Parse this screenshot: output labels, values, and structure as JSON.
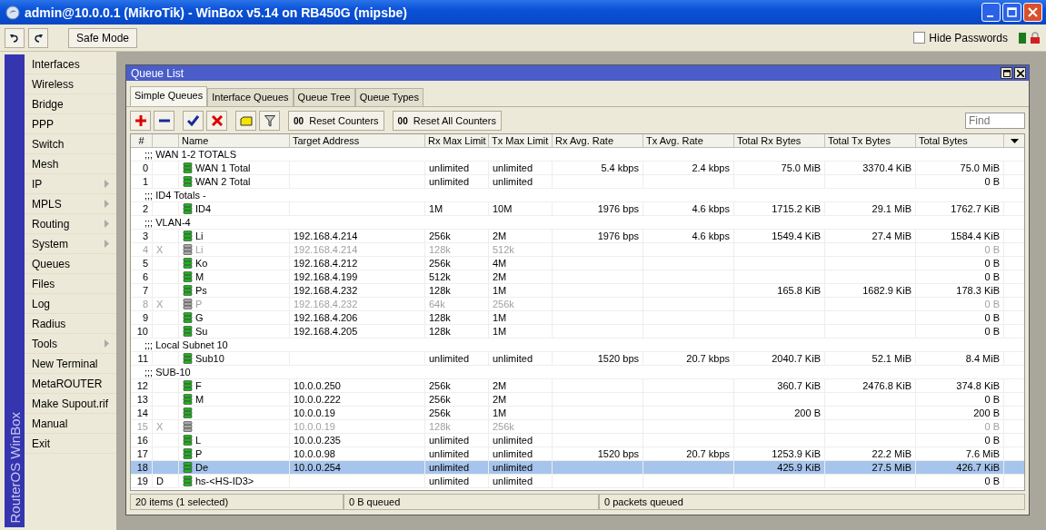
{
  "window": {
    "title": "admin@10.0.0.1 (MikroTik) - WinBox v5.14 on RB450G (mipsbe)"
  },
  "toolbar": {
    "safe_mode": "Safe Mode",
    "hide_passwords": {
      "label": "Hide Passwords",
      "checked": false
    }
  },
  "sidebar": {
    "brand": "RouterOS WinBox",
    "items": [
      {
        "label": "Interfaces",
        "submenu": false
      },
      {
        "label": "Wireless",
        "submenu": false
      },
      {
        "label": "Bridge",
        "submenu": false
      },
      {
        "label": "PPP",
        "submenu": false
      },
      {
        "label": "Switch",
        "submenu": false
      },
      {
        "label": "Mesh",
        "submenu": false
      },
      {
        "label": "IP",
        "submenu": true
      },
      {
        "label": "MPLS",
        "submenu": true
      },
      {
        "label": "Routing",
        "submenu": true
      },
      {
        "label": "System",
        "submenu": true
      },
      {
        "label": "Queues",
        "submenu": false
      },
      {
        "label": "Files",
        "submenu": false
      },
      {
        "label": "Log",
        "submenu": false
      },
      {
        "label": "Radius",
        "submenu": false
      },
      {
        "label": "Tools",
        "submenu": true
      },
      {
        "label": "New Terminal",
        "submenu": false
      },
      {
        "label": "MetaROUTER",
        "submenu": false
      },
      {
        "label": "Make Supout.rif",
        "submenu": false
      },
      {
        "label": "Manual",
        "submenu": false
      },
      {
        "label": "Exit",
        "submenu": false
      }
    ]
  },
  "queue_window": {
    "title": "Queue List",
    "tabs": [
      {
        "label": "Simple Queues",
        "selected": true
      },
      {
        "label": "Interface Queues",
        "selected": false
      },
      {
        "label": "Queue Tree",
        "selected": false
      },
      {
        "label": "Queue Types",
        "selected": false
      }
    ],
    "buttons": [
      {
        "label": "Reset Counters",
        "icon": "00"
      },
      {
        "label": "Reset All Counters",
        "icon": "00"
      }
    ],
    "find": {
      "placeholder": "Find"
    },
    "table": {
      "columns": [
        "#",
        "Name",
        "Target Address",
        "Rx Max Limit",
        "Tx Max Limit",
        "Rx Avg. Rate",
        "Tx Avg. Rate",
        "Total Rx Bytes",
        "Total Tx Bytes",
        "Total Bytes"
      ],
      "rows": [
        {
          "kind": "comment",
          "text": ";;; WAN 1-2 TOTALS"
        },
        {
          "kind": "queue",
          "num": "0",
          "name": "WAN 1 Total",
          "rx_max": "unlimited",
          "tx_max": "unlimited",
          "rx_avg": "5.4 kbps",
          "tx_avg": "2.4 kbps",
          "total_rx": "75.0 MiB",
          "total_tx": "3370.4 KiB",
          "total": "75.0 MiB",
          "disabled": false,
          "selected": false
        },
        {
          "kind": "queue",
          "num": "1",
          "name": "WAN 2 Total",
          "rx_max": "unlimited",
          "tx_max": "unlimited",
          "total": "0 B",
          "disabled": false,
          "selected": false
        },
        {
          "kind": "comment",
          "text": ";;; ID4 Totals -"
        },
        {
          "kind": "queue",
          "num": "2",
          "name": "ID4",
          "rx_max": "1M",
          "tx_max": "10M",
          "rx_avg": "1976 bps",
          "tx_avg": "4.6 kbps",
          "total_rx": "1715.2 KiB",
          "total_tx": "29.1 MiB",
          "total": "1762.7 KiB",
          "disabled": false,
          "selected": false
        },
        {
          "kind": "comment",
          "text": ";;; VLAN-4"
        },
        {
          "kind": "queue",
          "num": "3",
          "name": "Li",
          "target": "192.168.4.214",
          "rx_max": "256k",
          "tx_max": "2M",
          "rx_avg": "1976 bps",
          "tx_avg": "4.6 kbps",
          "total_rx": "1549.4 KiB",
          "total_tx": "27.4 MiB",
          "total": "1584.4 KiB",
          "disabled": false,
          "selected": false
        },
        {
          "kind": "queue",
          "num": "4",
          "flag": "X",
          "name": "Li",
          "target": "192.168.4.214",
          "rx_max": "128k",
          "tx_max": "512k",
          "total": "0 B",
          "disabled": true,
          "selected": false
        },
        {
          "kind": "queue",
          "num": "5",
          "name": "Ko",
          "target": "192.168.4.212",
          "rx_max": "256k",
          "tx_max": "4M",
          "total": "0 B",
          "disabled": false,
          "selected": false
        },
        {
          "kind": "queue",
          "num": "6",
          "name": "M",
          "target": "192.168.4.199",
          "rx_max": "512k",
          "tx_max": "2M",
          "total": "0 B",
          "disabled": false,
          "selected": false
        },
        {
          "kind": "queue",
          "num": "7",
          "name": "Ps",
          "target": "192.168.4.232",
          "rx_max": "128k",
          "tx_max": "1M",
          "total_rx": "165.8 KiB",
          "total_tx": "1682.9 KiB",
          "total": "178.3 KiB",
          "disabled": false,
          "selected": false
        },
        {
          "kind": "queue",
          "num": "8",
          "flag": "X",
          "name": "P",
          "target": "192.168.4.232",
          "rx_max": "64k",
          "tx_max": "256k",
          "total": "0 B",
          "disabled": true,
          "selected": false
        },
        {
          "kind": "queue",
          "num": "9",
          "name": "G",
          "target": "192.168.4.206",
          "rx_max": "128k",
          "tx_max": "1M",
          "total": "0 B",
          "disabled": false,
          "selected": false
        },
        {
          "kind": "queue",
          "num": "10",
          "name": "Su",
          "target": "192.168.4.205",
          "rx_max": "128k",
          "tx_max": "1M",
          "total": "0 B",
          "disabled": false,
          "selected": false
        },
        {
          "kind": "comment",
          "text": ";;; Local Subnet 10"
        },
        {
          "kind": "queue",
          "num": "11",
          "name": "Sub10",
          "rx_max": "unlimited",
          "tx_max": "unlimited",
          "rx_avg": "1520 bps",
          "tx_avg": "20.7 kbps",
          "total_rx": "2040.7 KiB",
          "total_tx": "52.1 MiB",
          "total": "8.4 MiB",
          "disabled": false,
          "selected": false
        },
        {
          "kind": "comment",
          "text": ";;; SUB-10"
        },
        {
          "kind": "queue",
          "num": "12",
          "name": "F",
          "target": "10.0.0.250",
          "rx_max": "256k",
          "tx_max": "2M",
          "total_rx": "360.7 KiB",
          "total_tx": "2476.8 KiB",
          "total": "374.8 KiB",
          "disabled": false,
          "selected": false
        },
        {
          "kind": "queue",
          "num": "13",
          "name": "M",
          "target": "10.0.0.222",
          "rx_max": "256k",
          "tx_max": "2M",
          "total": "0 B",
          "disabled": false,
          "selected": false
        },
        {
          "kind": "queue",
          "num": "14",
          "target": "10.0.0.19",
          "rx_max": "256k",
          "tx_max": "1M",
          "total_rx": "200 B",
          "total": "200 B",
          "disabled": false,
          "selected": false
        },
        {
          "kind": "queue",
          "num": "15",
          "flag": "X",
          "target": "10.0.0.19",
          "rx_max": "128k",
          "tx_max": "256k",
          "total": "0 B",
          "disabled": true,
          "selected": false
        },
        {
          "kind": "queue",
          "num": "16",
          "name": "L",
          "target": "10.0.0.235",
          "rx_max": "unlimited",
          "tx_max": "unlimited",
          "total": "0 B",
          "disabled": false,
          "selected": false
        },
        {
          "kind": "queue",
          "num": "17",
          "name": "P",
          "target": "10.0.0.98",
          "rx_max": "unlimited",
          "tx_max": "unlimited",
          "rx_avg": "1520 bps",
          "tx_avg": "20.7 kbps",
          "total_rx": "1253.9 KiB",
          "total_tx": "22.2 MiB",
          "total": "7.6 MiB",
          "disabled": false,
          "selected": false
        },
        {
          "kind": "queue",
          "num": "18",
          "name": "De",
          "target": "10.0.0.254",
          "rx_max": "unlimited",
          "tx_max": "unlimited",
          "total_rx": "425.9 KiB",
          "total_tx": "27.5 MiB",
          "total": "426.7 KiB",
          "disabled": false,
          "selected": true
        },
        {
          "kind": "queue",
          "num": "19",
          "flag": "D",
          "name": "hs-<HS-ID3>",
          "rx_max": "unlimited",
          "tx_max": "unlimited",
          "total": "0 B",
          "disabled": false,
          "selected": false
        }
      ]
    },
    "status_bar": [
      "20 items (1 selected)",
      "0 B queued",
      "0 packets queued"
    ]
  }
}
